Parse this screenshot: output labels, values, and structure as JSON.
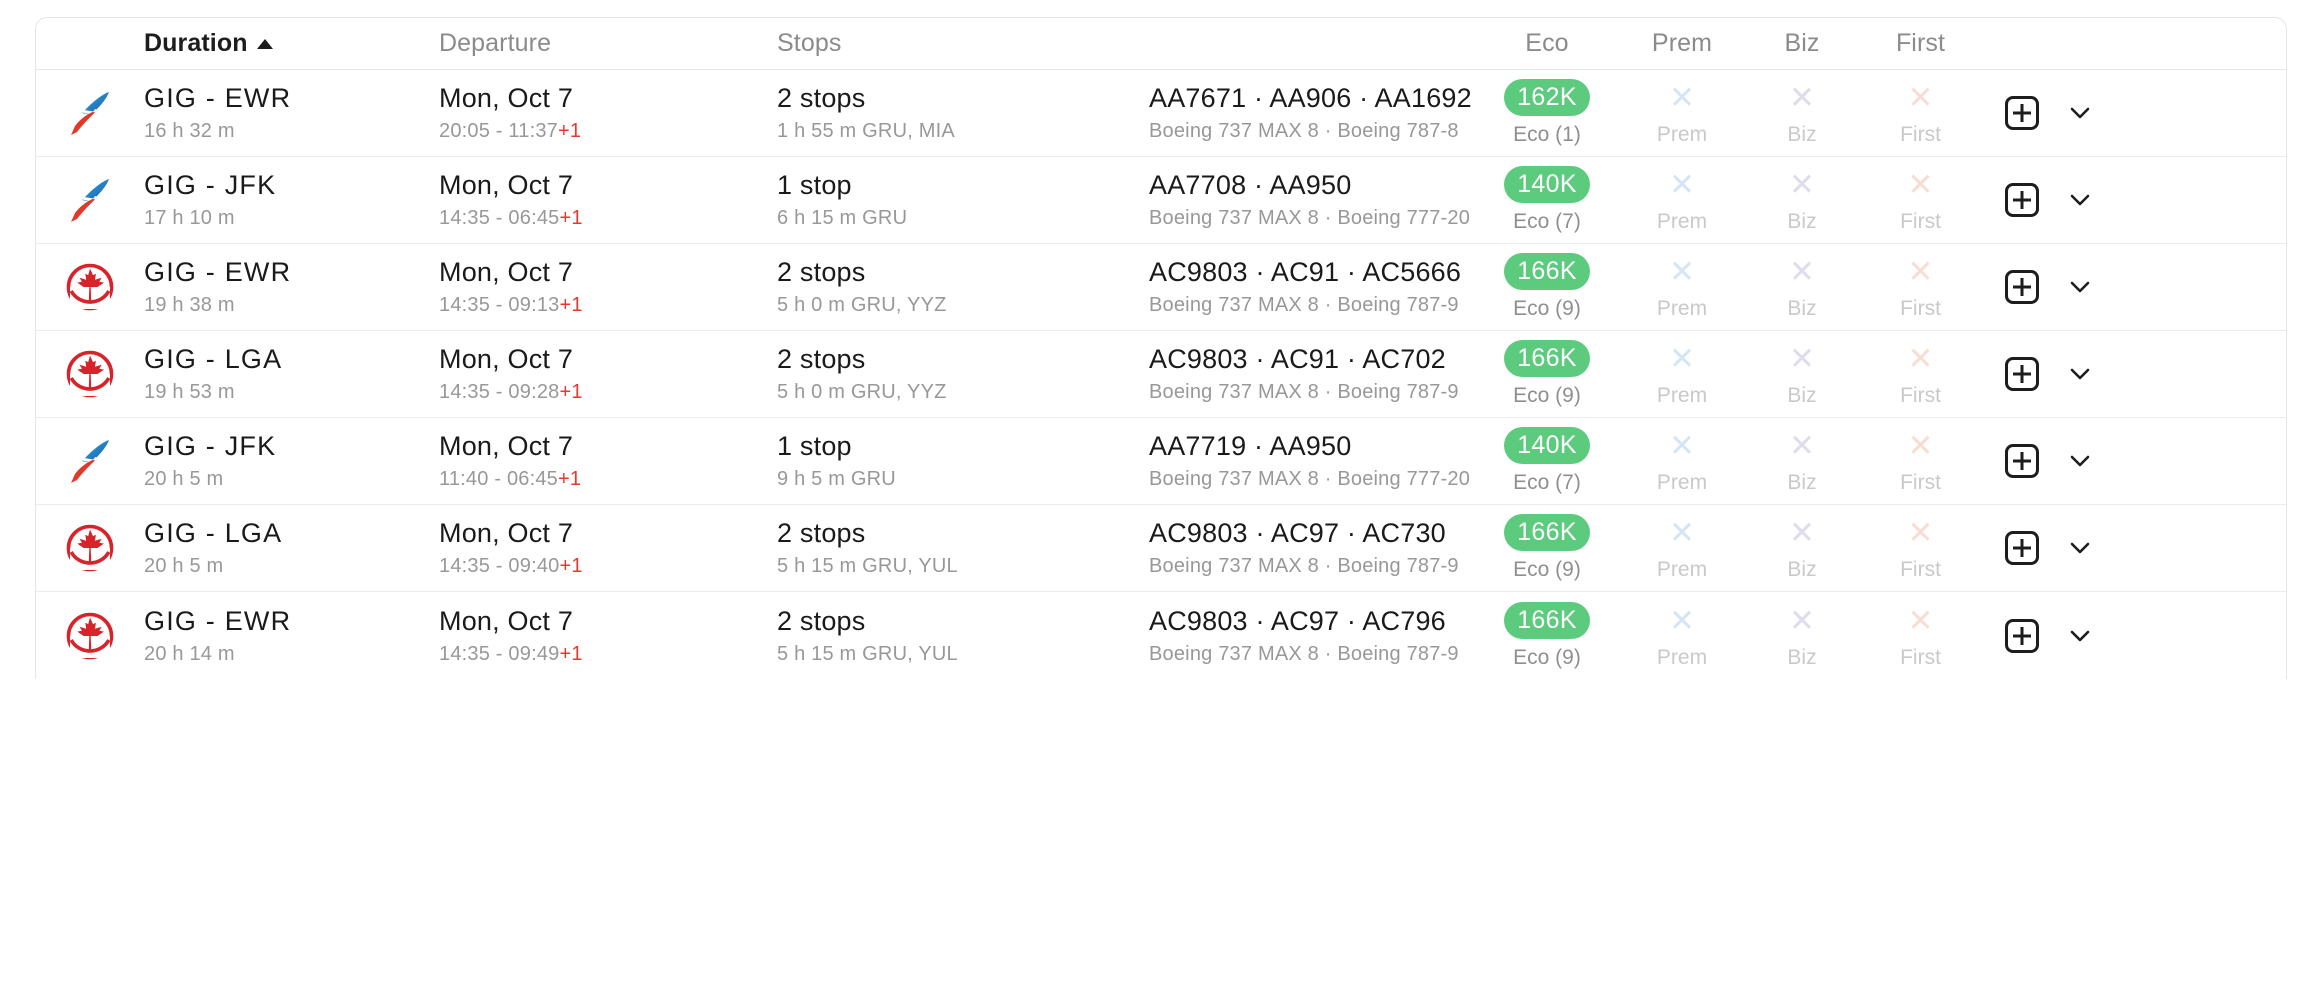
{
  "table": {
    "columns": {
      "duration": "Duration",
      "departure": "Departure",
      "stops": "Stops",
      "flights": "",
      "eco": "Eco",
      "prem": "Prem",
      "biz": "Biz",
      "first": "First"
    },
    "sort": {
      "column": "Duration",
      "direction": "asc",
      "caret": "triangle-up-icon"
    },
    "colors": {
      "badge_green": "#5ccb7e",
      "next_day_red": "#e8392e",
      "x_prem": "#d4e6f5",
      "x_biz": "#e0dced",
      "x_first": "#f8ddd3",
      "row_border": "#ebebeb"
    },
    "rows": [
      {
        "airline": "american-airlines",
        "route": "GIG - EWR",
        "duration": "16 h 32 m",
        "date": "Mon, Oct 7",
        "times": "20:05 - 11:37",
        "next_day": "+1",
        "stops": "2 stops",
        "layover": "1 h 55 m  GRU, MIA",
        "flight_numbers": "AA7671  ·  AA906  ·  AA1692",
        "aircraft": "Boeing 737 MAX 8  ·  Boeing 787-8",
        "eco": {
          "price": "162K",
          "label": "Eco (1)",
          "available": true
        },
        "prem": {
          "label": "Prem",
          "available": false
        },
        "biz": {
          "label": "Biz",
          "available": false
        },
        "first": {
          "label": "First",
          "available": false
        }
      },
      {
        "airline": "american-airlines",
        "route": "GIG - JFK",
        "duration": "17 h 10 m",
        "date": "Mon, Oct 7",
        "times": "14:35 - 06:45",
        "next_day": "+1",
        "stops": "1 stop",
        "layover": "6 h 15 m  GRU",
        "flight_numbers": "AA7708  ·  AA950",
        "aircraft": "Boeing 737 MAX 8  ·  Boeing 777-20",
        "eco": {
          "price": "140K",
          "label": "Eco (7)",
          "available": true
        },
        "prem": {
          "label": "Prem",
          "available": false
        },
        "biz": {
          "label": "Biz",
          "available": false
        },
        "first": {
          "label": "First",
          "available": false
        }
      },
      {
        "airline": "air-canada",
        "route": "GIG - EWR",
        "duration": "19 h 38 m",
        "date": "Mon, Oct 7",
        "times": "14:35 - 09:13",
        "next_day": "+1",
        "stops": "2 stops",
        "layover": "5 h 0 m  GRU, YYZ",
        "flight_numbers": "AC9803  ·  AC91  ·  AC5666",
        "aircraft": "Boeing 737 MAX 8  ·  Boeing 787-9",
        "eco": {
          "price": "166K",
          "label": "Eco (9)",
          "available": true
        },
        "prem": {
          "label": "Prem",
          "available": false
        },
        "biz": {
          "label": "Biz",
          "available": false
        },
        "first": {
          "label": "First",
          "available": false
        }
      },
      {
        "airline": "air-canada",
        "route": "GIG - LGA",
        "duration": "19 h 53 m",
        "date": "Mon, Oct 7",
        "times": "14:35 - 09:28",
        "next_day": "+1",
        "stops": "2 stops",
        "layover": "5 h 0 m  GRU, YYZ",
        "flight_numbers": "AC9803  ·  AC91  ·  AC702",
        "aircraft": "Boeing 737 MAX 8  ·  Boeing 787-9",
        "eco": {
          "price": "166K",
          "label": "Eco (9)",
          "available": true
        },
        "prem": {
          "label": "Prem",
          "available": false
        },
        "biz": {
          "label": "Biz",
          "available": false
        },
        "first": {
          "label": "First",
          "available": false
        }
      },
      {
        "airline": "american-airlines",
        "route": "GIG - JFK",
        "duration": "20 h 5 m",
        "date": "Mon, Oct 7",
        "times": "11:40 - 06:45",
        "next_day": "+1",
        "stops": "1 stop",
        "layover": "9 h 5 m  GRU",
        "flight_numbers": "AA7719  ·  AA950",
        "aircraft": "Boeing 737 MAX 8  ·  Boeing 777-20",
        "eco": {
          "price": "140K",
          "label": "Eco (7)",
          "available": true
        },
        "prem": {
          "label": "Prem",
          "available": false
        },
        "biz": {
          "label": "Biz",
          "available": false
        },
        "first": {
          "label": "First",
          "available": false
        }
      },
      {
        "airline": "air-canada",
        "route": "GIG - LGA",
        "duration": "20 h 5 m",
        "date": "Mon, Oct 7",
        "times": "14:35 - 09:40",
        "next_day": "+1",
        "stops": "2 stops",
        "layover": "5 h 15 m  GRU, YUL",
        "flight_numbers": "AC9803  ·  AC97  ·  AC730",
        "aircraft": "Boeing 737 MAX 8  ·  Boeing 787-9",
        "eco": {
          "price": "166K",
          "label": "Eco (9)",
          "available": true
        },
        "prem": {
          "label": "Prem",
          "available": false
        },
        "biz": {
          "label": "Biz",
          "available": false
        },
        "first": {
          "label": "First",
          "available": false
        }
      },
      {
        "airline": "air-canada",
        "route": "GIG - EWR",
        "duration": "20 h 14 m",
        "date": "Mon, Oct 7",
        "times": "14:35 - 09:49",
        "next_day": "+1",
        "stops": "2 stops",
        "layover": "5 h 15 m  GRU, YUL",
        "flight_numbers": "AC9803  ·  AC97  ·  AC796",
        "aircraft": "Boeing 737 MAX 8  ·  Boeing 787-9",
        "eco": {
          "price": "166K",
          "label": "Eco (9)",
          "available": true
        },
        "prem": {
          "label": "Prem",
          "available": false
        },
        "biz": {
          "label": "Biz",
          "available": false
        },
        "first": {
          "label": "First",
          "available": false
        }
      }
    ],
    "row_actions": {
      "add": "add-to-compare-icon",
      "expand": "chevron-down-icon"
    }
  }
}
